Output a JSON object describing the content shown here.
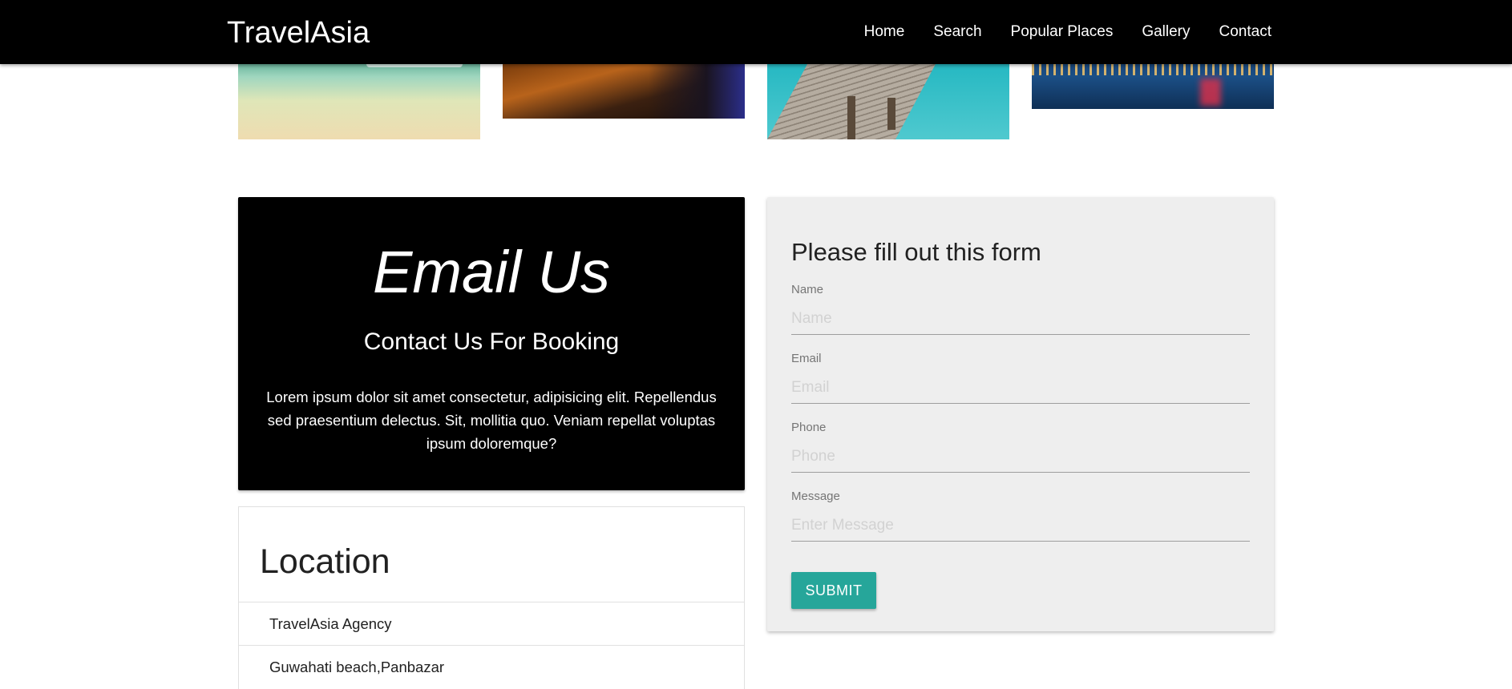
{
  "navbar": {
    "brand": "TravelAsia",
    "links": [
      "Home",
      "Search",
      "Popular Places",
      "Gallery",
      "Contact"
    ]
  },
  "gallery": {
    "photos": [
      "beach-photo",
      "bar-photo",
      "pier-photo",
      "city-photo"
    ]
  },
  "email_card": {
    "title": "Email Us",
    "subtitle": "Contact Us For Booking",
    "body": "Lorem ipsum dolor sit amet consectetur, adipisicing elit. Repellendus sed praesentium delectus. Sit, mollitia quo. Veniam repellat voluptas ipsum doloremque?"
  },
  "location": {
    "title": "Location",
    "items": [
      "TravelAsia Agency",
      "Guwahati beach,Panbazar"
    ]
  },
  "form": {
    "heading": "Please fill out this form",
    "fields": [
      {
        "label": "Name",
        "placeholder": "Name",
        "value": ""
      },
      {
        "label": "Email",
        "placeholder": "Email",
        "value": ""
      },
      {
        "label": "Phone",
        "placeholder": "Phone",
        "value": ""
      },
      {
        "label": "Message",
        "placeholder": "Enter Message",
        "value": ""
      }
    ],
    "submit_label": "Submit"
  },
  "colors": {
    "navbar_bg": "#000000",
    "email_card_bg": "#000000",
    "form_bg": "#eeeeee",
    "submit_bg": "#26a69a"
  }
}
